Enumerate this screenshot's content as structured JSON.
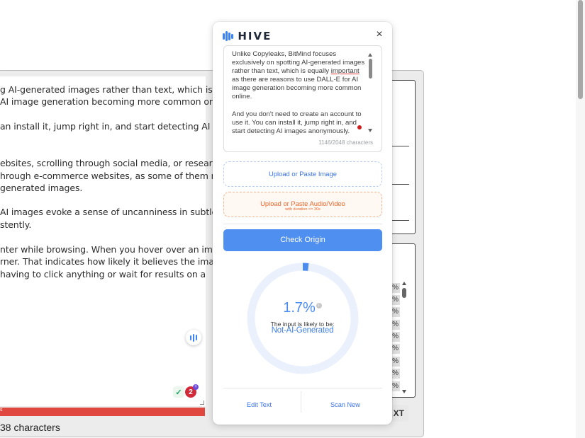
{
  "background_editor": {
    "lines": [
      "g AI-generated images rather than text, which is",
      " AI image generation becoming more common online.",
      "an install it, jump right in, and start detecting AI images",
      "ebsites, scrolling through social media, or researching",
      "hrough e-commerce websites, as some of them may",
      " generated images.",
      "AI images evoke a sense of uncanniness in subtle ways,",
      "stently.",
      "nter while browsing. When you hover over an image,",
      "rner. That indicates how likely it believes the image was",
      "having to click anything or wait for results on a"
    ],
    "char_count_text": "38 characters",
    "badge_count": "2",
    "badge_plus": "+",
    "grammar_icon_glyph": "✓",
    "right_button_text": "XT",
    "percent_label": "%",
    "red_bar_text": "s"
  },
  "panel": {
    "brand": "HIVE",
    "close_glyph": "×",
    "input_text": {
      "paragraph1_before": "Unlike Copyleaks, BitMind focuses exclusively on spotting AI-generated images rather than text, which is equally ",
      "paragraph1_underlined": "important",
      "paragraph1_after": " as there are reasons to use DALL-E for AI image generation becoming more common online.",
      "paragraph2": "And you don't need to create an account to use it. You can install it, jump right in, and start detecting AI images anonymously."
    },
    "char_counter": "1146/2048 characters",
    "upload_image_label": "Upload or Paste Image",
    "upload_audio_label": "Upload or Paste Audio/Video",
    "upload_audio_sublabel": "with duration <= 30s",
    "check_button_label": "Check Origin",
    "result": {
      "score_text": "1.7%",
      "score_fraction": 0.017,
      "info_glyph": "i",
      "caption": "The input is likely to be:",
      "verdict": "Not-AI-Generated"
    },
    "footer": {
      "edit_label": "Edit Text",
      "scan_label": "Scan New"
    }
  },
  "colors": {
    "accent_blue": "#4e8ff0",
    "audio_orange": "#ea6a2d",
    "gauge_track": "#eaf1fd",
    "gauge_fill": "#4a8cf0"
  }
}
